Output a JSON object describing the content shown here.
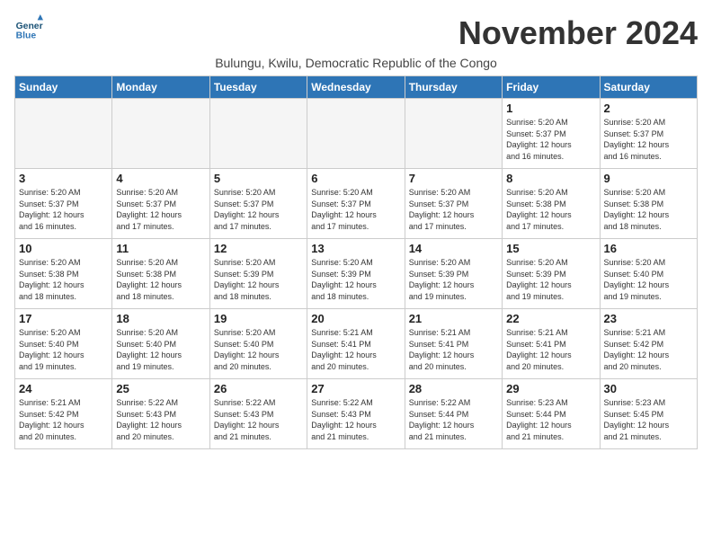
{
  "logo": {
    "line1": "General",
    "line2": "Blue"
  },
  "title": "November 2024",
  "subtitle": "Bulungu, Kwilu, Democratic Republic of the Congo",
  "days_of_week": [
    "Sunday",
    "Monday",
    "Tuesday",
    "Wednesday",
    "Thursday",
    "Friday",
    "Saturday"
  ],
  "weeks": [
    [
      {
        "day": "",
        "info": ""
      },
      {
        "day": "",
        "info": ""
      },
      {
        "day": "",
        "info": ""
      },
      {
        "day": "",
        "info": ""
      },
      {
        "day": "",
        "info": ""
      },
      {
        "day": "1",
        "info": "Sunrise: 5:20 AM\nSunset: 5:37 PM\nDaylight: 12 hours\nand 16 minutes."
      },
      {
        "day": "2",
        "info": "Sunrise: 5:20 AM\nSunset: 5:37 PM\nDaylight: 12 hours\nand 16 minutes."
      }
    ],
    [
      {
        "day": "3",
        "info": "Sunrise: 5:20 AM\nSunset: 5:37 PM\nDaylight: 12 hours\nand 16 minutes."
      },
      {
        "day": "4",
        "info": "Sunrise: 5:20 AM\nSunset: 5:37 PM\nDaylight: 12 hours\nand 17 minutes."
      },
      {
        "day": "5",
        "info": "Sunrise: 5:20 AM\nSunset: 5:37 PM\nDaylight: 12 hours\nand 17 minutes."
      },
      {
        "day": "6",
        "info": "Sunrise: 5:20 AM\nSunset: 5:37 PM\nDaylight: 12 hours\nand 17 minutes."
      },
      {
        "day": "7",
        "info": "Sunrise: 5:20 AM\nSunset: 5:37 PM\nDaylight: 12 hours\nand 17 minutes."
      },
      {
        "day": "8",
        "info": "Sunrise: 5:20 AM\nSunset: 5:38 PM\nDaylight: 12 hours\nand 17 minutes."
      },
      {
        "day": "9",
        "info": "Sunrise: 5:20 AM\nSunset: 5:38 PM\nDaylight: 12 hours\nand 18 minutes."
      }
    ],
    [
      {
        "day": "10",
        "info": "Sunrise: 5:20 AM\nSunset: 5:38 PM\nDaylight: 12 hours\nand 18 minutes."
      },
      {
        "day": "11",
        "info": "Sunrise: 5:20 AM\nSunset: 5:38 PM\nDaylight: 12 hours\nand 18 minutes."
      },
      {
        "day": "12",
        "info": "Sunrise: 5:20 AM\nSunset: 5:39 PM\nDaylight: 12 hours\nand 18 minutes."
      },
      {
        "day": "13",
        "info": "Sunrise: 5:20 AM\nSunset: 5:39 PM\nDaylight: 12 hours\nand 18 minutes."
      },
      {
        "day": "14",
        "info": "Sunrise: 5:20 AM\nSunset: 5:39 PM\nDaylight: 12 hours\nand 19 minutes."
      },
      {
        "day": "15",
        "info": "Sunrise: 5:20 AM\nSunset: 5:39 PM\nDaylight: 12 hours\nand 19 minutes."
      },
      {
        "day": "16",
        "info": "Sunrise: 5:20 AM\nSunset: 5:40 PM\nDaylight: 12 hours\nand 19 minutes."
      }
    ],
    [
      {
        "day": "17",
        "info": "Sunrise: 5:20 AM\nSunset: 5:40 PM\nDaylight: 12 hours\nand 19 minutes."
      },
      {
        "day": "18",
        "info": "Sunrise: 5:20 AM\nSunset: 5:40 PM\nDaylight: 12 hours\nand 19 minutes."
      },
      {
        "day": "19",
        "info": "Sunrise: 5:20 AM\nSunset: 5:40 PM\nDaylight: 12 hours\nand 20 minutes."
      },
      {
        "day": "20",
        "info": "Sunrise: 5:21 AM\nSunset: 5:41 PM\nDaylight: 12 hours\nand 20 minutes."
      },
      {
        "day": "21",
        "info": "Sunrise: 5:21 AM\nSunset: 5:41 PM\nDaylight: 12 hours\nand 20 minutes."
      },
      {
        "day": "22",
        "info": "Sunrise: 5:21 AM\nSunset: 5:41 PM\nDaylight: 12 hours\nand 20 minutes."
      },
      {
        "day": "23",
        "info": "Sunrise: 5:21 AM\nSunset: 5:42 PM\nDaylight: 12 hours\nand 20 minutes."
      }
    ],
    [
      {
        "day": "24",
        "info": "Sunrise: 5:21 AM\nSunset: 5:42 PM\nDaylight: 12 hours\nand 20 minutes."
      },
      {
        "day": "25",
        "info": "Sunrise: 5:22 AM\nSunset: 5:43 PM\nDaylight: 12 hours\nand 20 minutes."
      },
      {
        "day": "26",
        "info": "Sunrise: 5:22 AM\nSunset: 5:43 PM\nDaylight: 12 hours\nand 21 minutes."
      },
      {
        "day": "27",
        "info": "Sunrise: 5:22 AM\nSunset: 5:43 PM\nDaylight: 12 hours\nand 21 minutes."
      },
      {
        "day": "28",
        "info": "Sunrise: 5:22 AM\nSunset: 5:44 PM\nDaylight: 12 hours\nand 21 minutes."
      },
      {
        "day": "29",
        "info": "Sunrise: 5:23 AM\nSunset: 5:44 PM\nDaylight: 12 hours\nand 21 minutes."
      },
      {
        "day": "30",
        "info": "Sunrise: 5:23 AM\nSunset: 5:45 PM\nDaylight: 12 hours\nand 21 minutes."
      }
    ]
  ]
}
